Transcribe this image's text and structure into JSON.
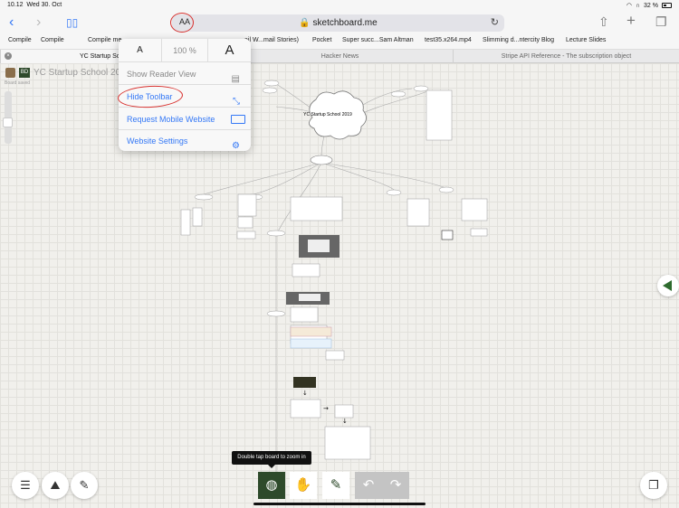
{
  "status": {
    "time": "10.12",
    "date": "Wed 30. Oct",
    "battery": "32 %"
  },
  "browser": {
    "aa_label": "AA",
    "url": "sketchboard.me",
    "favorites": [
      "Compile",
      "Compile",
      "Compile me",
      "ail W...mail Stories)",
      "Pocket",
      "Super succ...Sam Altman",
      "test35.x264.mp4",
      "Slimming d...ntercity Blog",
      "Lecture Slides"
    ],
    "tabs": [
      "YC Startup School 2019",
      "Hacker News",
      "Stripe API Reference - The subscription object"
    ]
  },
  "popover": {
    "font_small": "A",
    "zoom": "100 %",
    "font_large": "A",
    "items": [
      {
        "label": "Show Reader View",
        "icon": "reader-icon"
      },
      {
        "label": "Hide Toolbar",
        "icon": "expand-arrows-icon"
      },
      {
        "label": "Request Mobile Website",
        "icon": "mobile-icon"
      },
      {
        "label": "Website Settings",
        "icon": "settings-gear-icon"
      }
    ]
  },
  "board": {
    "initials": "BD",
    "title": "YC Startup School 2019",
    "saved": "Board saved",
    "center_node": "YC Startup School 2019"
  },
  "toolbar": {
    "tooltip": "Double tap board to zoom in"
  },
  "colors": {
    "accent": "#3478f6",
    "annotation": "#d8312e",
    "tool_active": "#2e4a2b"
  }
}
